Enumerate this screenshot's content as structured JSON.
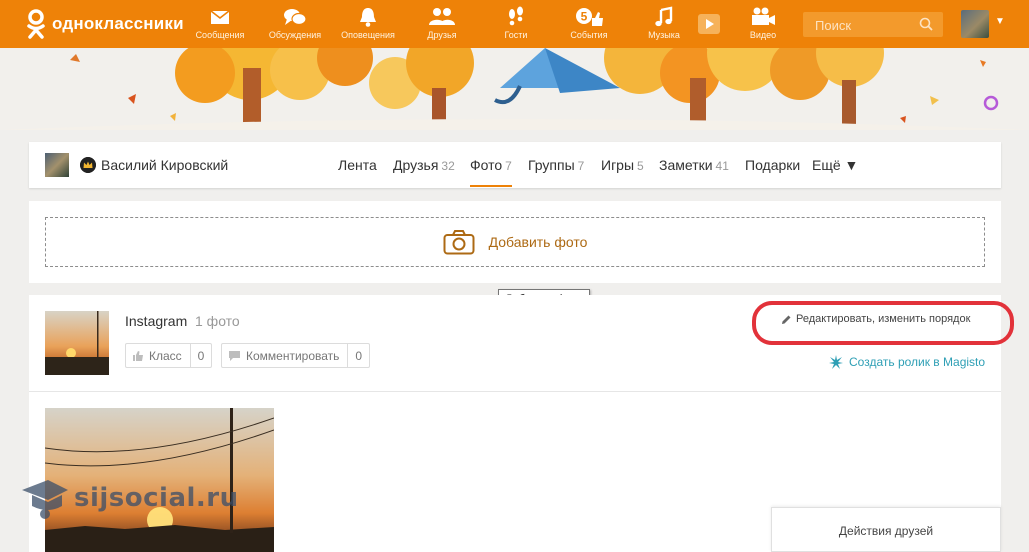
{
  "topbar": {
    "brand": "одноклассники",
    "nav": [
      {
        "label": "Сообщения",
        "icon": "envelope-icon"
      },
      {
        "label": "Обсуждения",
        "icon": "chat-bubbles-icon"
      },
      {
        "label": "Оповещения",
        "icon": "bell-icon"
      },
      {
        "label": "Друзья",
        "icon": "friends-icon"
      },
      {
        "label": "Гости",
        "icon": "footprints-icon"
      },
      {
        "label": "События",
        "icon": "events-like-icon",
        "badge": "5"
      },
      {
        "label": "Музыка",
        "icon": "music-note-icon"
      },
      {
        "label": "Видео",
        "icon": "video-camera-icon"
      }
    ],
    "search_placeholder": "Поиск"
  },
  "profile": {
    "name": "Василий Кировский",
    "tabs": [
      {
        "label": "Лента",
        "count": ""
      },
      {
        "label": "Друзья",
        "count": "32"
      },
      {
        "label": "Фото",
        "count": "7"
      },
      {
        "label": "Группы",
        "count": "7"
      },
      {
        "label": "Игры",
        "count": "5"
      },
      {
        "label": "Заметки",
        "count": "41"
      },
      {
        "label": "Подарки",
        "count": ""
      },
      {
        "label": "Ещё ▼",
        "count": ""
      }
    ]
  },
  "add_photo": {
    "label": "Добавить фото",
    "tooltip": "Добавить фото"
  },
  "album": {
    "title": "Instagram",
    "count": "1 фото",
    "like_label": "Класс",
    "like_count": "0",
    "comment_label": "Комментировать",
    "comment_count": "0",
    "edit_label": "Редактировать, изменить порядок",
    "magisto_label": "Создать ролик в Magisto"
  },
  "watermark": "sijsocial.ru",
  "friends_panel": "Действия друзей",
  "colors": {
    "brand": "#ee8208",
    "highlight": "#e2323a",
    "link": "#2e9fb5"
  }
}
